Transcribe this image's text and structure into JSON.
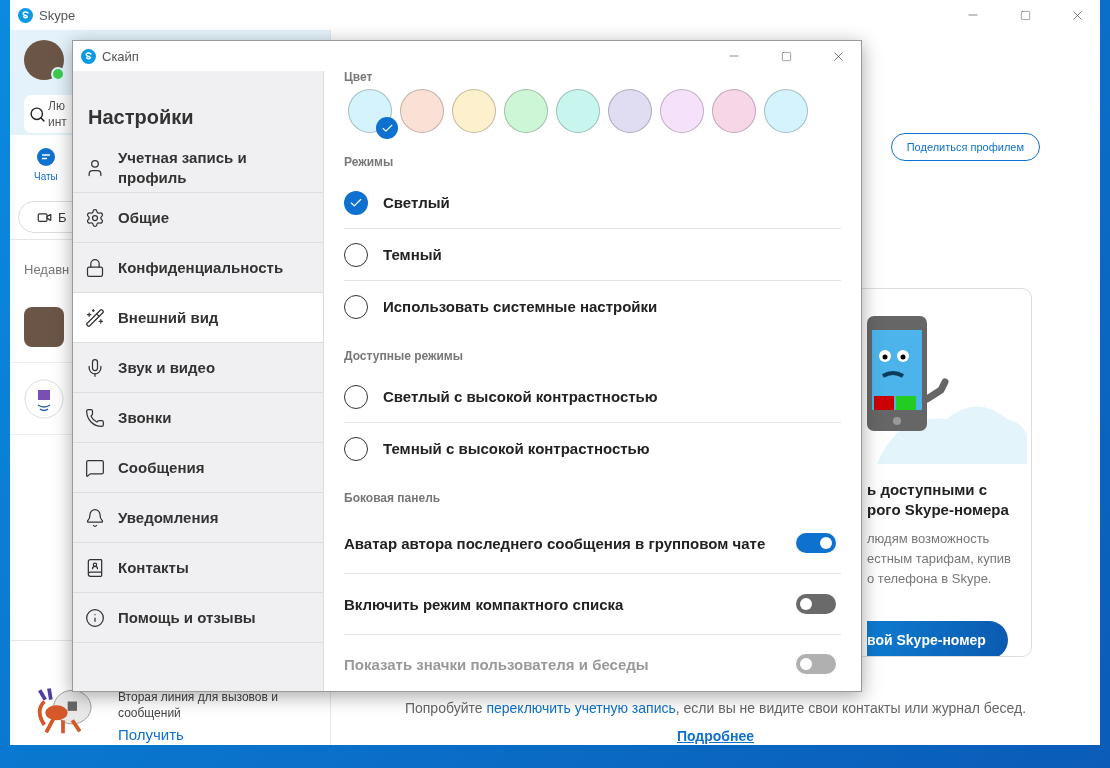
{
  "main_window": {
    "title": "Skype",
    "search": {
      "placeholder": "Лю инт"
    },
    "chats_tab": {
      "label": "Чаты",
      "selected": true
    },
    "meet_button": {
      "label": "Б"
    },
    "recent_heading": "Недавн",
    "share_button": "Поделиться профилем",
    "promo": {
      "title_lines": [
        "ь доступными с",
        "рого Skype-номера"
      ],
      "text_lines": [
        "людям возможность",
        "естным тарифам, купив",
        "о телефона в Skype."
      ],
      "button": "вой Skype-номер"
    },
    "footer": {
      "text_before": "Попробуйте ",
      "link": "переключить учетную запись",
      "text_after": ", если вы не видите свои контакты или журнал бесед.",
      "more_link": "Подробнее"
    },
    "second_line": {
      "text": "Вторая линия для вызовов и сообщений",
      "action": "Получить"
    }
  },
  "settings_dialog": {
    "title": "Скайп",
    "heading": "Настройки",
    "nav": [
      {
        "label": "Учетная запись и профиль",
        "selected": false
      },
      {
        "label": "Общие",
        "selected": false
      },
      {
        "label": "Конфиденциальность",
        "selected": false
      },
      {
        "label": "Внешний вид",
        "selected": true
      },
      {
        "label": "Звук и видео",
        "selected": false
      },
      {
        "label": "Звонки",
        "selected": false
      },
      {
        "label": "Сообщения",
        "selected": false
      },
      {
        "label": "Уведомления",
        "selected": false
      },
      {
        "label": "Контакты",
        "selected": false
      },
      {
        "label": "Помощь и отзывы",
        "selected": false
      }
    ],
    "color_label": "Цвет",
    "colors": [
      {
        "color": "#d4f3fd",
        "selected": true
      },
      {
        "color": "#fbe0d6",
        "selected": false
      },
      {
        "color": "#fdf0cc",
        "selected": false
      },
      {
        "color": "#cdf6d6",
        "selected": false
      },
      {
        "color": "#c8f6ee",
        "selected": false
      },
      {
        "color": "#e0dcf2",
        "selected": false
      },
      {
        "color": "#f5e1fa",
        "selected": false
      },
      {
        "color": "#f7d6e8",
        "selected": false
      },
      {
        "color": "#d4f3fd",
        "selected": false
      }
    ],
    "sections": [
      {
        "title": "Режимы",
        "items": [
          {
            "kind": "radio",
            "label": "Светлый",
            "selected": true
          },
          {
            "kind": "radio",
            "label": "Темный",
            "selected": false
          },
          {
            "kind": "radio",
            "label": "Использовать системные настройки",
            "selected": false
          }
        ]
      },
      {
        "title": "Доступные режимы",
        "items": [
          {
            "kind": "radio",
            "label": "Светлый с высокой контрастностью",
            "selected": false
          },
          {
            "kind": "radio",
            "label": "Темный с высокой контрастностью",
            "selected": false
          }
        ]
      },
      {
        "title": "Боковая панель",
        "items": [
          {
            "kind": "toggle",
            "label": "Аватар автора последнего сообщения в групповом чате",
            "on": true,
            "disabled": false
          },
          {
            "kind": "toggle",
            "label": "Включить режим компактного списка",
            "on": false,
            "disabled": false
          },
          {
            "kind": "toggle",
            "label": "Показать значки пользователя и беседы",
            "on": false,
            "disabled": true
          }
        ]
      }
    ]
  }
}
